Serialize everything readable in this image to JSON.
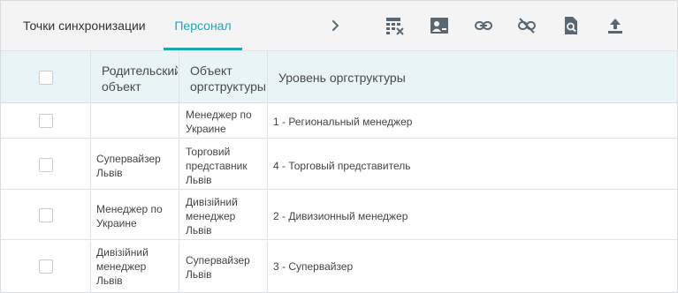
{
  "tabs": [
    {
      "label": "Точки синхронизации",
      "active": false
    },
    {
      "label": "Персонал",
      "active": true
    }
  ],
  "toolbar": {
    "icons": [
      "chevron-right-icon",
      "table-remove-icon",
      "user-card-icon",
      "link-icon",
      "unlink-icon",
      "document-search-icon",
      "upload-icon"
    ]
  },
  "table": {
    "headers": {
      "parent": "Родительский\nобъект",
      "object": "Объект\nоргструктуры",
      "level": "Уровень оргструктуры"
    },
    "rows": [
      {
        "parent": "",
        "object": "Менеджер по\nУкраине",
        "level": "1 - Региональный менеджер"
      },
      {
        "parent": "Супервайзер\nЛьвів",
        "object": "Торговий\nпредставник\nЛьвів",
        "level": "4 - Торговый представитель"
      },
      {
        "parent": "Менеджер по\nУкраине",
        "object": "Дивізійний\nменеджер\nЛьвів",
        "level": "2 - Дивизионный менеджер"
      },
      {
        "parent": "Дивізійний\nменеджер\nЛьвів",
        "object": "Супервайзер\nЛьвів",
        "level": "3 - Супервайзер"
      }
    ]
  },
  "colors": {
    "accent": "#1fa6b4",
    "icon": "#5b6770",
    "header_bg": "#e8f4f6",
    "tabbar_bg": "#f4f4f4"
  }
}
